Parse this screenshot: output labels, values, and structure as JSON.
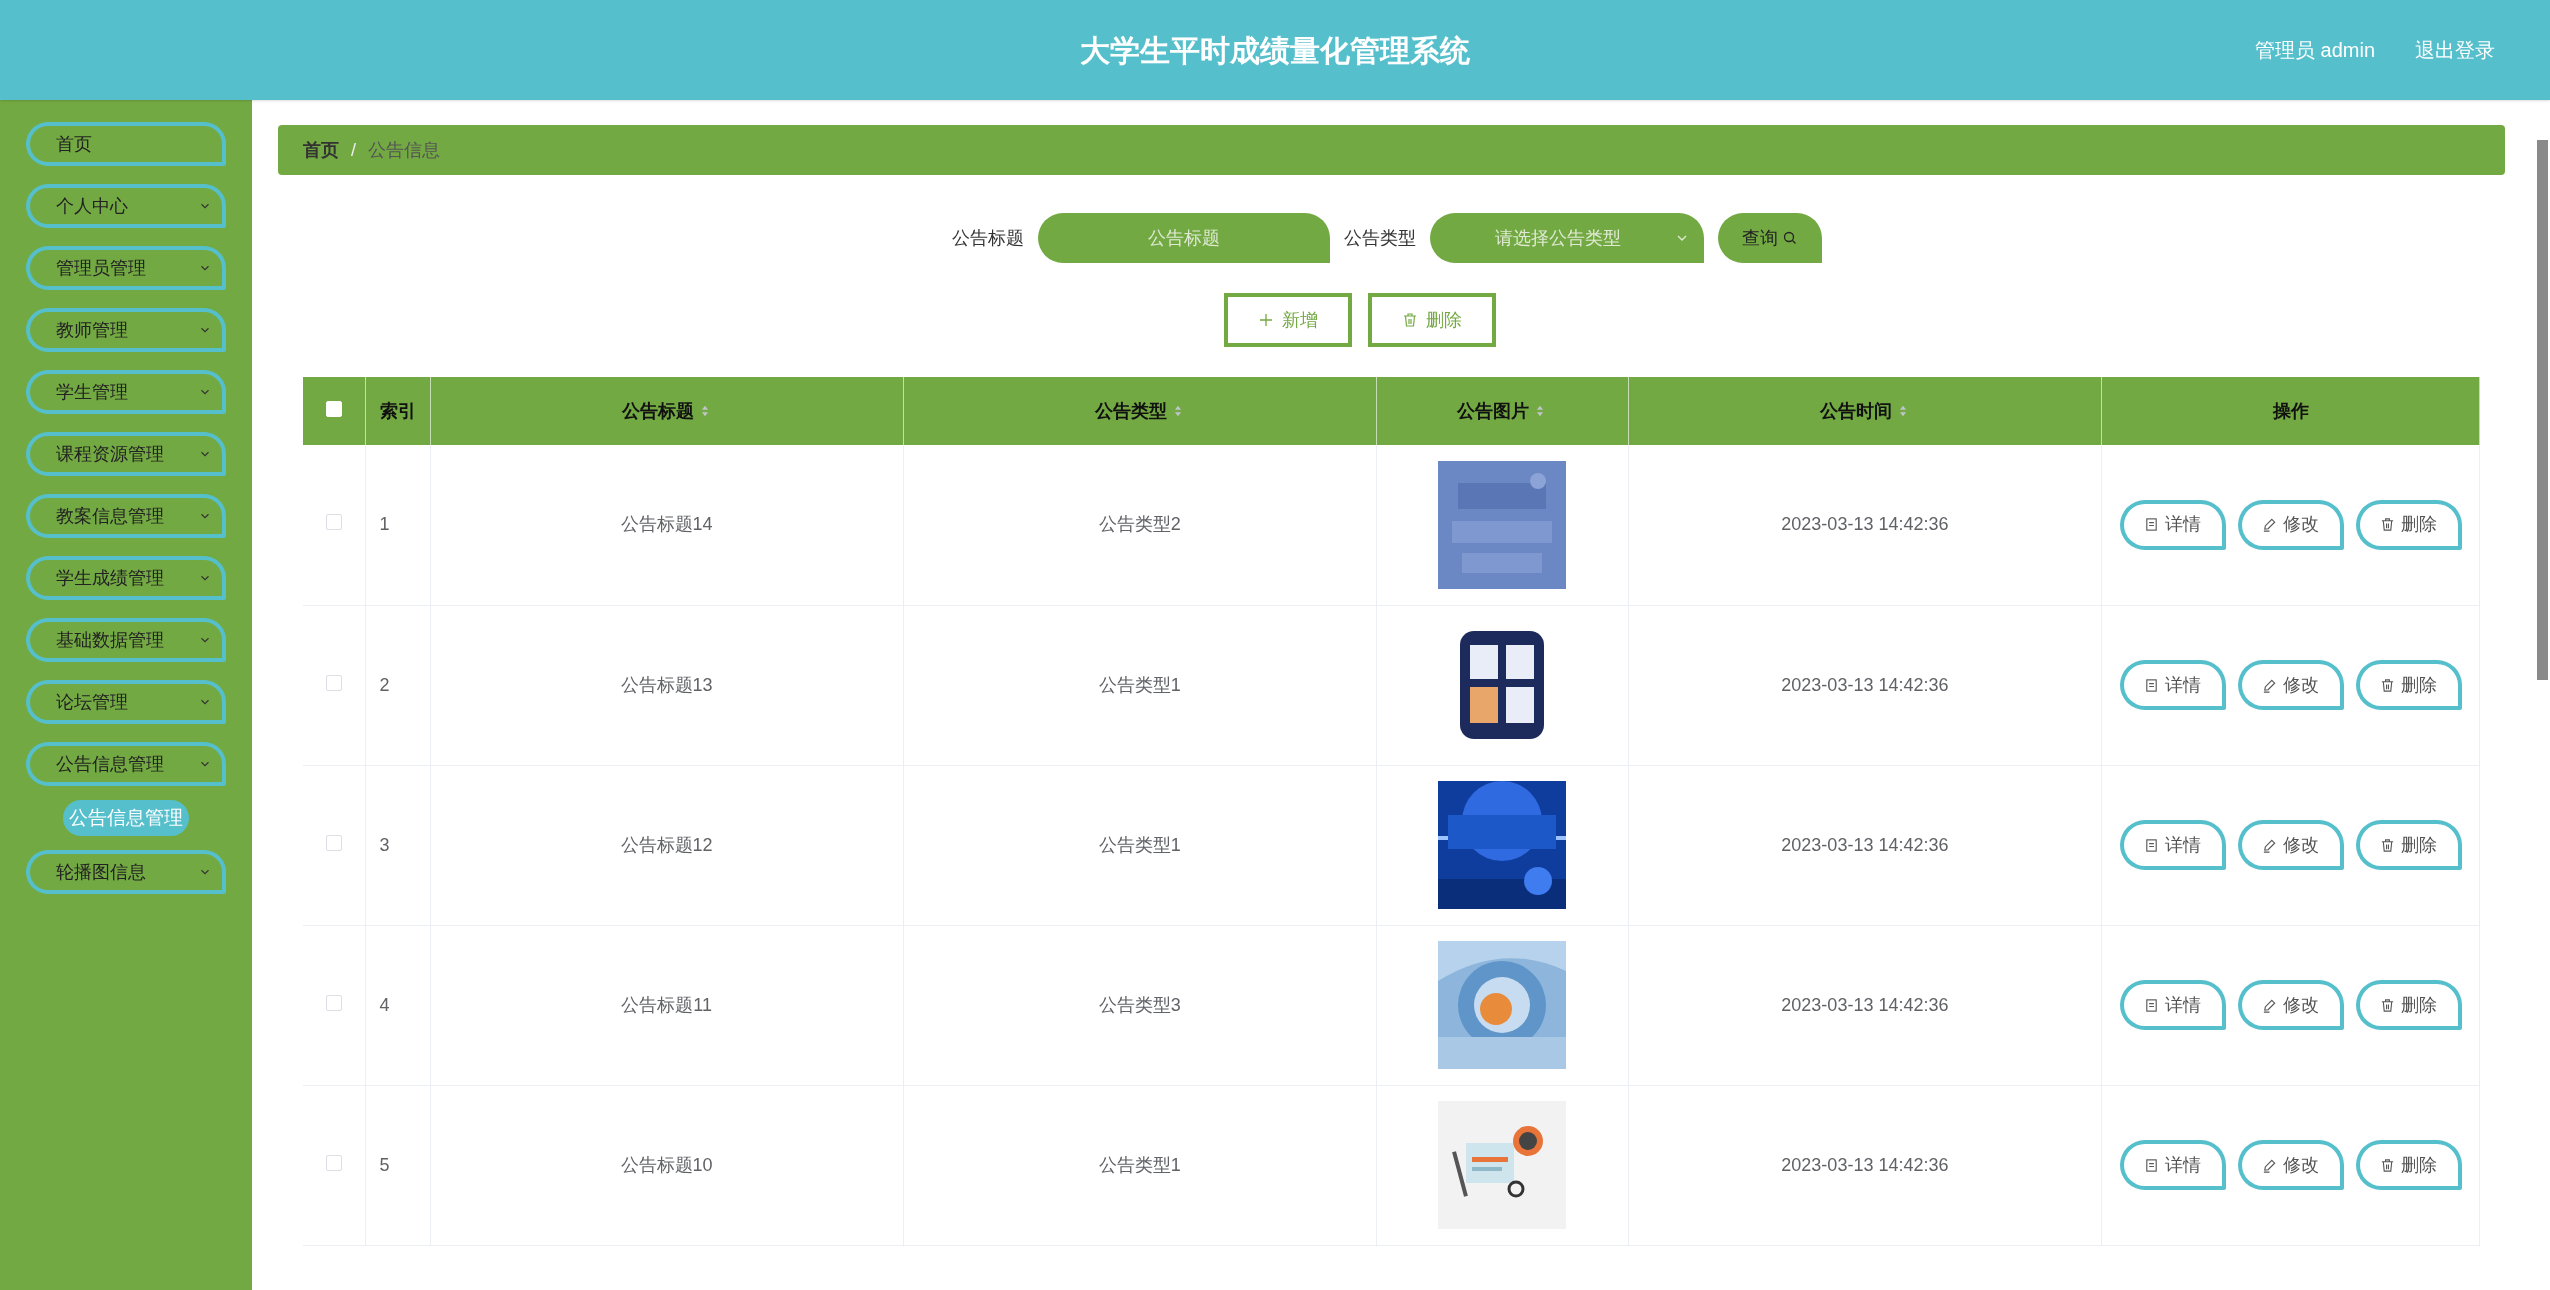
{
  "header": {
    "title": "大学生平时成绩量化管理系统",
    "user": "管理员 admin",
    "logout": "退出登录"
  },
  "sidebar": {
    "items": [
      {
        "label": "首页",
        "has_children": false
      },
      {
        "label": "个人中心",
        "has_children": true
      },
      {
        "label": "管理员管理",
        "has_children": true
      },
      {
        "label": "教师管理",
        "has_children": true
      },
      {
        "label": "学生管理",
        "has_children": true
      },
      {
        "label": "课程资源管理",
        "has_children": true
      },
      {
        "label": "教案信息管理",
        "has_children": true
      },
      {
        "label": "学生成绩管理",
        "has_children": true
      },
      {
        "label": "基础数据管理",
        "has_children": true
      },
      {
        "label": "论坛管理",
        "has_children": true
      },
      {
        "label": "公告信息管理",
        "has_children": true,
        "children": [
          {
            "label": "公告信息管理",
            "selected": true
          }
        ]
      },
      {
        "label": "轮播图信息",
        "has_children": true
      }
    ]
  },
  "breadcrumb": {
    "items": [
      "首页",
      "公告信息"
    ],
    "separator": "/"
  },
  "search": {
    "fields": [
      {
        "label": "公告标题",
        "placeholder": "公告标题",
        "kind": "input"
      },
      {
        "label": "公告类型",
        "placeholder": "请选择公告类型",
        "kind": "select"
      }
    ],
    "button": "查询"
  },
  "actions": [
    {
      "label": "新增",
      "kind": "add"
    },
    {
      "label": "删除",
      "kind": "delete"
    }
  ],
  "table": {
    "columns": [
      {
        "label": "索引",
        "sortable": false
      },
      {
        "label": "公告标题",
        "sortable": true
      },
      {
        "label": "公告类型",
        "sortable": true
      },
      {
        "label": "公告图片",
        "sortable": true
      },
      {
        "label": "公告时间",
        "sortable": true
      },
      {
        "label": "操作",
        "sortable": false
      }
    ],
    "header_checked": false,
    "rows": [
      {
        "index": "1",
        "title": "公告标题14",
        "type": "公告类型2",
        "time": "2023-03-13 14:42:36",
        "checked": false,
        "buttons": [
          {
            "label": "详情",
            "kind": "detail"
          },
          {
            "label": "修改",
            "kind": "edit"
          },
          {
            "label": "删除",
            "kind": "delete"
          }
        ]
      },
      {
        "index": "2",
        "title": "公告标题13",
        "type": "公告类型1",
        "time": "2023-03-13 14:42:36",
        "checked": false,
        "buttons": [
          {
            "label": "详情",
            "kind": "detail"
          },
          {
            "label": "修改",
            "kind": "edit"
          },
          {
            "label": "删除",
            "kind": "delete"
          }
        ]
      },
      {
        "index": "3",
        "title": "公告标题12",
        "type": "公告类型1",
        "time": "2023-03-13 14:42:36",
        "checked": false,
        "buttons": [
          {
            "label": "详情",
            "kind": "detail"
          },
          {
            "label": "修改",
            "kind": "edit"
          },
          {
            "label": "删除",
            "kind": "delete"
          }
        ]
      },
      {
        "index": "4",
        "title": "公告标题11",
        "type": "公告类型3",
        "time": "2023-03-13 14:42:36",
        "checked": false,
        "buttons": [
          {
            "label": "详情",
            "kind": "detail"
          },
          {
            "label": "修改",
            "kind": "edit"
          },
          {
            "label": "删除",
            "kind": "delete"
          }
        ]
      },
      {
        "index": "5",
        "title": "公告标题10",
        "type": "公告类型1",
        "time": "2023-03-13 14:42:36",
        "checked": false,
        "buttons": [
          {
            "label": "详情",
            "kind": "detail"
          },
          {
            "label": "修改",
            "kind": "edit"
          },
          {
            "label": "删除",
            "kind": "delete"
          }
        ]
      }
    ]
  }
}
